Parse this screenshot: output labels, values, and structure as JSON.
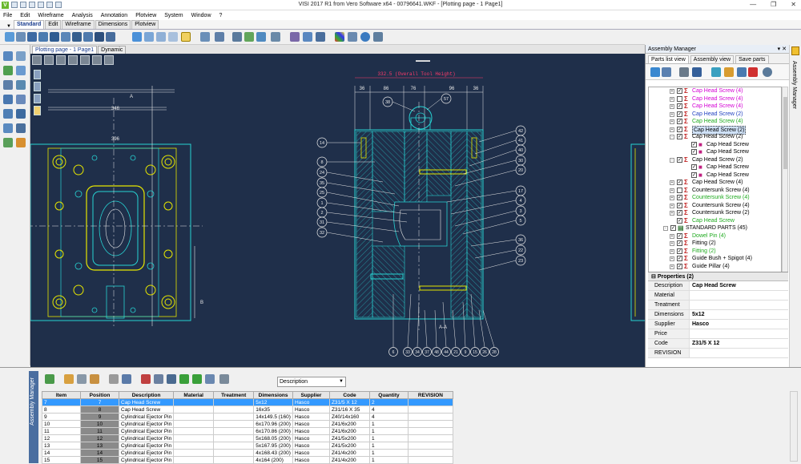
{
  "window": {
    "title": "VISI 2017 R1   from Vero Software x64 - 00796641.WKF - [Plotting page - 1 Page1]",
    "app_icon": "V"
  },
  "menu": [
    "File",
    "Edit",
    "Wireframe",
    "Analysis",
    "Annotation",
    "Plotview",
    "System",
    "Window",
    "?"
  ],
  "ribbon_tabs": [
    {
      "label": "Standard",
      "active": true
    },
    {
      "label": "Edit"
    },
    {
      "label": "Wireframe"
    },
    {
      "label": "Dimensions"
    },
    {
      "label": "Plotview"
    }
  ],
  "doc_tabs": [
    {
      "label": "Plotting page - 1 Page1",
      "active": true
    },
    {
      "label": "Dynamic"
    }
  ],
  "drawing": {
    "overall_width_label": "332.5  (Overall Tool Height)",
    "top_dims": [
      "36",
      "86",
      "76",
      "96",
      "36"
    ],
    "left_dims": [
      "396",
      "346"
    ],
    "left_balloons": [
      "14",
      "8",
      "24",
      "35",
      "25",
      "1",
      "2",
      "31",
      "32"
    ],
    "right_balloons": [
      "42",
      "41",
      "40",
      "30",
      "20",
      "17",
      "4",
      "3",
      "5",
      "36",
      "22",
      "23"
    ],
    "top_balloons": [
      "38",
      "57"
    ],
    "bottom_balloons": [
      "6",
      "33",
      "34",
      "37",
      "48",
      "44",
      "21",
      "9",
      "15",
      "26",
      "28"
    ],
    "section_label": "A-A",
    "marker_a": "A",
    "marker_b": "B"
  },
  "assembly": {
    "title": "Assembly Manager",
    "tabs": [
      {
        "label": "Parts list view",
        "active": true
      },
      {
        "label": "Assembly view"
      },
      {
        "label": "Save parts"
      }
    ],
    "tree": [
      {
        "label": "Cap Head Screw (4)",
        "color": "#d400d4",
        "level": 0,
        "checked": true,
        "expand": "+"
      },
      {
        "label": "Cap Head Screw (4)",
        "color": "#d400d4",
        "level": 0,
        "checked": false,
        "expand": "+"
      },
      {
        "label": "Cap Head Screw (4)",
        "color": "#d400d4",
        "level": 0,
        "checked": true,
        "expand": "+"
      },
      {
        "label": "Cap Head Screw (2)",
        "color": "#1f3fc0",
        "level": 0,
        "checked": true,
        "expand": "+"
      },
      {
        "label": "Cap Head Screw (4)",
        "color": "#1faa1f",
        "level": 0,
        "checked": true,
        "expand": "+"
      },
      {
        "label": "Cap Head Screw (2)",
        "color": "#000000",
        "level": 0,
        "checked": true,
        "expand": "+",
        "selected": true
      },
      {
        "label": "Cap Head Screw (2)",
        "color": "#000000",
        "level": 0,
        "checked": true,
        "expand": "-"
      },
      {
        "label": "Cap Head Screw",
        "color": "#000000",
        "level": 1,
        "checked": true,
        "leaf": true
      },
      {
        "label": "Cap Head Screw",
        "color": "#000000",
        "level": 1,
        "checked": true,
        "leaf": true
      },
      {
        "label": "Cap Head Screw (2)",
        "color": "#000000",
        "level": 0,
        "checked": true,
        "expand": "-"
      },
      {
        "label": "Cap Head Screw",
        "color": "#000000",
        "level": 1,
        "checked": true,
        "leaf": true
      },
      {
        "label": "Cap Head Screw",
        "color": "#000000",
        "level": 1,
        "checked": true,
        "leaf": true
      },
      {
        "label": "Cap Head Screw (4)",
        "color": "#000000",
        "level": 0,
        "checked": true,
        "expand": "+"
      },
      {
        "label": "Countersunk Screw (4)",
        "color": "#000000",
        "level": 0,
        "checked": false,
        "expand": "+"
      },
      {
        "label": "Countersunk Screw (4)",
        "color": "#1faa1f",
        "level": 0,
        "checked": true,
        "expand": "+"
      },
      {
        "label": "Countersunk Screw (4)",
        "color": "#000000",
        "level": 0,
        "checked": true,
        "expand": "+"
      },
      {
        "label": "Countersunk Screw (2)",
        "color": "#000000",
        "level": 0,
        "checked": true,
        "expand": "+"
      },
      {
        "label": "Cap Head Screw",
        "color": "#1faa1f",
        "level": 0,
        "checked": true,
        "leaf": true
      },
      {
        "label": "STANDARD PARTS (45)",
        "color": "#000000",
        "level": -1,
        "checked": true,
        "expand": "-"
      },
      {
        "label": "Dowel Pin (4)",
        "color": "#1faa1f",
        "level": 0,
        "checked": true,
        "expand": "+"
      },
      {
        "label": "Fitting (2)",
        "color": "#000000",
        "level": 0,
        "checked": true,
        "expand": "+"
      },
      {
        "label": "Fitting (2)",
        "color": "#1faa1f",
        "level": 0,
        "checked": true,
        "expand": "+"
      },
      {
        "label": "Guide Bush + Spigot  (4)",
        "color": "#000000",
        "level": 0,
        "checked": true,
        "expand": "+"
      },
      {
        "label": "Guide Pillar (4)",
        "color": "#000000",
        "level": 0,
        "checked": true,
        "expand": "+"
      }
    ],
    "properties_title": "Properties (2)",
    "properties": [
      {
        "key": "Description",
        "value": "Cap Head Screw"
      },
      {
        "key": "Material",
        "value": ""
      },
      {
        "key": "Treatment",
        "value": ""
      },
      {
        "key": "Dimensions",
        "value": "5x12"
      },
      {
        "key": "Supplier",
        "value": "Hasco"
      },
      {
        "key": "Price",
        "value": ""
      },
      {
        "key": "Code",
        "value": "Z31/5 X 12"
      },
      {
        "key": "REVISION",
        "value": ""
      }
    ]
  },
  "right_strip_label": "Assembly Manager",
  "bottom": {
    "panel_label": "Assembly Manager",
    "filter_select": "Description",
    "columns": [
      "Item",
      "Position",
      "Description",
      "Material",
      "Treatment",
      "Dimensions",
      "Supplier",
      "Code",
      "Quantity",
      "REVISION"
    ],
    "rows": [
      {
        "item": "7",
        "pos": "7",
        "desc": "Cap Head Screw",
        "mat": "",
        "treat": "",
        "dim": "5x12",
        "sup": "Hasco",
        "code": "Z31/5 X 12",
        "qty": "2",
        "rev": "",
        "selected": true
      },
      {
        "item": "8",
        "pos": "8",
        "desc": "Cap Head Screw",
        "mat": "",
        "treat": "",
        "dim": "16x35",
        "sup": "Hasco",
        "code": "Z31/16 X 35",
        "qty": "4",
        "rev": ""
      },
      {
        "item": "9",
        "pos": "9",
        "desc": "Cylindrical Ejector Pin",
        "mat": "",
        "treat": "",
        "dim": "14x149.5 (160)",
        "sup": "Hasco",
        "code": "Z40/14x160",
        "qty": "4",
        "rev": ""
      },
      {
        "item": "10",
        "pos": "10",
        "desc": "Cylindrical Ejector Pin",
        "mat": "",
        "treat": "",
        "dim": "6x170.96 (200)",
        "sup": "Hasco",
        "code": "Z41/6x200",
        "qty": "1",
        "rev": ""
      },
      {
        "item": "11",
        "pos": "11",
        "desc": "Cylindrical Ejector Pin",
        "mat": "",
        "treat": "",
        "dim": "6x170.86 (200)",
        "sup": "Hasco",
        "code": "Z41/6x200",
        "qty": "1",
        "rev": ""
      },
      {
        "item": "12",
        "pos": "12",
        "desc": "Cylindrical Ejector Pin",
        "mat": "",
        "treat": "",
        "dim": "5x168.05 (200)",
        "sup": "Hasco",
        "code": "Z41/5x200",
        "qty": "1",
        "rev": ""
      },
      {
        "item": "13",
        "pos": "13",
        "desc": "Cylindrical Ejector Pin",
        "mat": "",
        "treat": "",
        "dim": "5x167.95 (200)",
        "sup": "Hasco",
        "code": "Z41/5x200",
        "qty": "1",
        "rev": ""
      },
      {
        "item": "14",
        "pos": "14",
        "desc": "Cylindrical Ejector Pin",
        "mat": "",
        "treat": "",
        "dim": "4x168.43 (200)",
        "sup": "Hasco",
        "code": "Z41/4x200",
        "qty": "1",
        "rev": ""
      },
      {
        "item": "15",
        "pos": "15",
        "desc": "Cylindrical Ejector Pin",
        "mat": "",
        "treat": "",
        "dim": "4x164 (200)",
        "sup": "Hasco",
        "code": "Z41/4x200",
        "qty": "1",
        "rev": ""
      }
    ]
  },
  "colors": {
    "canvas_bg": "#1f2f4a",
    "cad_cyan": "#27d3d3",
    "cad_yellow": "#e6e600",
    "cad_white": "#e8e8e8",
    "cad_red": "#ff3a6a",
    "selection": "#3399ff"
  }
}
